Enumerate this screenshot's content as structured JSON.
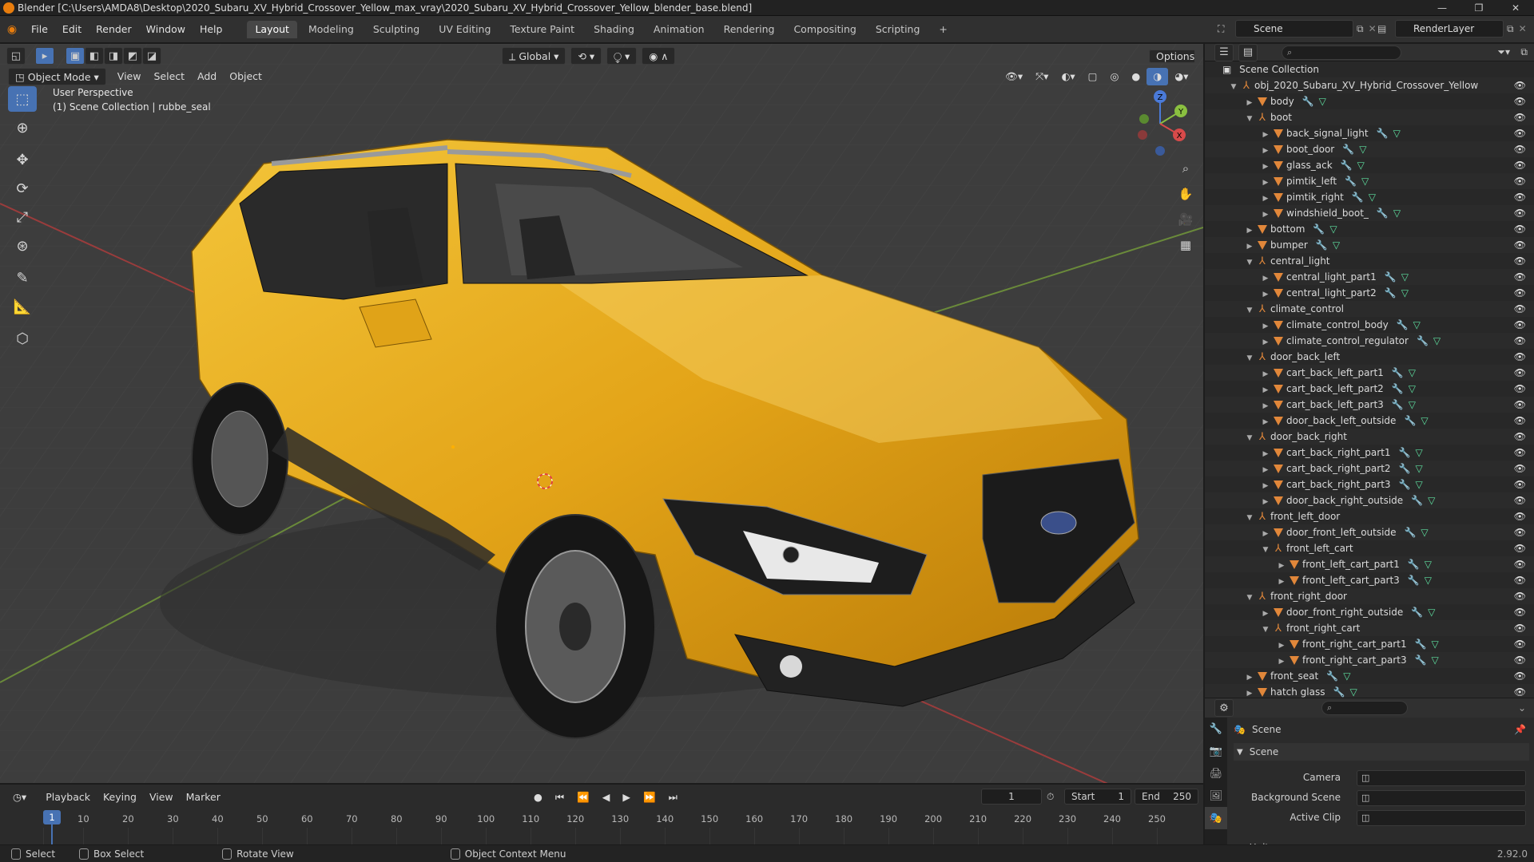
{
  "window": {
    "title": "Blender [C:\\Users\\AMDA8\\Desktop\\2020_Subaru_XV_Hybrid_Crossover_Yellow_max_vray\\2020_Subaru_XV_Hybrid_Crossover_Yellow_blender_base.blend]"
  },
  "menus": [
    "File",
    "Edit",
    "Render",
    "Window",
    "Help"
  ],
  "workspaces": [
    "Layout",
    "Modeling",
    "Sculpting",
    "UV Editing",
    "Texture Paint",
    "Shading",
    "Animation",
    "Rendering",
    "Compositing",
    "Scripting"
  ],
  "workspace_add": "+",
  "scene_name": "Scene",
  "render_layer": "RenderLayer",
  "viewport": {
    "mode": "Object Mode",
    "header_menus": [
      "View",
      "Select",
      "Add",
      "Object"
    ],
    "transform_orientation": "Global",
    "options_label": "Options",
    "overlay_line1": "User Perspective",
    "overlay_line2": "(1) Scene Collection | rubbe_seal",
    "gizmo_axes": {
      "x": "X",
      "y": "Y",
      "z": "Z"
    }
  },
  "outliner": {
    "root": "Scene Collection",
    "items": [
      {
        "name": "obj_2020_Subaru_XV_Hybrid_Crossover_Yellow",
        "depth": 1,
        "type": "empty",
        "open": true
      },
      {
        "name": "body",
        "depth": 2,
        "type": "mesh",
        "open": false
      },
      {
        "name": "boot",
        "depth": 2,
        "type": "empty",
        "open": true
      },
      {
        "name": "back_signal_light",
        "depth": 3,
        "type": "mesh",
        "open": false
      },
      {
        "name": "boot_door",
        "depth": 3,
        "type": "mesh",
        "open": false
      },
      {
        "name": "glass_ack",
        "depth": 3,
        "type": "mesh",
        "open": false
      },
      {
        "name": "pimtik_left",
        "depth": 3,
        "type": "mesh",
        "open": false
      },
      {
        "name": "pimtik_right",
        "depth": 3,
        "type": "mesh",
        "open": false
      },
      {
        "name": "windshield_boot_",
        "depth": 3,
        "type": "mesh",
        "open": false
      },
      {
        "name": "bottom",
        "depth": 2,
        "type": "mesh",
        "open": false
      },
      {
        "name": "bumper",
        "depth": 2,
        "type": "mesh",
        "open": false
      },
      {
        "name": "central_light",
        "depth": 2,
        "type": "empty",
        "open": true
      },
      {
        "name": "central_light_part1",
        "depth": 3,
        "type": "mesh",
        "open": false
      },
      {
        "name": "central_light_part2",
        "depth": 3,
        "type": "mesh",
        "open": false
      },
      {
        "name": "climate_control",
        "depth": 2,
        "type": "empty",
        "open": true
      },
      {
        "name": "climate_control_body",
        "depth": 3,
        "type": "mesh",
        "open": false
      },
      {
        "name": "climate_control_regulator",
        "depth": 3,
        "type": "mesh",
        "open": false
      },
      {
        "name": "door_back_left",
        "depth": 2,
        "type": "empty",
        "open": true
      },
      {
        "name": "cart_back_left_part1",
        "depth": 3,
        "type": "mesh",
        "open": false
      },
      {
        "name": "cart_back_left_part2",
        "depth": 3,
        "type": "mesh",
        "open": false
      },
      {
        "name": "cart_back_left_part3",
        "depth": 3,
        "type": "mesh",
        "open": false
      },
      {
        "name": "door_back_left_outside",
        "depth": 3,
        "type": "mesh",
        "open": false
      },
      {
        "name": "door_back_right",
        "depth": 2,
        "type": "empty",
        "open": true
      },
      {
        "name": "cart_back_right_part1",
        "depth": 3,
        "type": "mesh",
        "open": false
      },
      {
        "name": "cart_back_right_part2",
        "depth": 3,
        "type": "mesh",
        "open": false
      },
      {
        "name": "cart_back_right_part3",
        "depth": 3,
        "type": "mesh",
        "open": false
      },
      {
        "name": "door_back_right_outside",
        "depth": 3,
        "type": "mesh",
        "open": false
      },
      {
        "name": "front_left_door",
        "depth": 2,
        "type": "empty",
        "open": true
      },
      {
        "name": "door_front_left_outside",
        "depth": 3,
        "type": "mesh",
        "open": false
      },
      {
        "name": "front_left_cart",
        "depth": 3,
        "type": "empty",
        "open": true
      },
      {
        "name": "front_left_cart_part1",
        "depth": 4,
        "type": "mesh",
        "open": false
      },
      {
        "name": "front_left_cart_part3",
        "depth": 4,
        "type": "mesh",
        "open": false
      },
      {
        "name": "front_right_door",
        "depth": 2,
        "type": "empty",
        "open": true
      },
      {
        "name": "door_front_right_outside",
        "depth": 3,
        "type": "mesh",
        "open": false
      },
      {
        "name": "front_right_cart",
        "depth": 3,
        "type": "empty",
        "open": true
      },
      {
        "name": "front_right_cart_part1",
        "depth": 4,
        "type": "mesh",
        "open": false
      },
      {
        "name": "front_right_cart_part3",
        "depth": 4,
        "type": "mesh",
        "open": false
      },
      {
        "name": "front_seat",
        "depth": 2,
        "type": "mesh",
        "open": false
      },
      {
        "name": "hatch glass",
        "depth": 2,
        "type": "mesh",
        "open": false
      }
    ]
  },
  "properties": {
    "context": "Scene",
    "panel": "Scene",
    "fields": [
      {
        "label": "Camera",
        "value": ""
      },
      {
        "label": "Background Scene",
        "value": ""
      },
      {
        "label": "Active Clip",
        "value": ""
      }
    ],
    "next_panel": "Units"
  },
  "timeline": {
    "menus": [
      "Playback",
      "Keying",
      "View",
      "Marker"
    ],
    "current_frame": "1",
    "start_label": "Start",
    "start": "1",
    "end_label": "End",
    "end": "250",
    "ticks": [
      "1",
      "10",
      "20",
      "30",
      "40",
      "50",
      "60",
      "70",
      "80",
      "90",
      "100",
      "110",
      "120",
      "130",
      "140",
      "150",
      "160",
      "170",
      "180",
      "190",
      "200",
      "210",
      "220",
      "230",
      "240",
      "250"
    ]
  },
  "statusbar": {
    "select": "Select",
    "box_select": "Box Select",
    "rotate_view": "Rotate View",
    "context_menu": "Object Context Menu",
    "version": "2.92.0"
  },
  "colors": {
    "accent": "#4772b3",
    "car_yellow": "#e3a418",
    "mesh_icon": "#e1873a",
    "modifier_icon": "#7fa8d6",
    "mesh_data_icon": "#5ee0a0"
  }
}
